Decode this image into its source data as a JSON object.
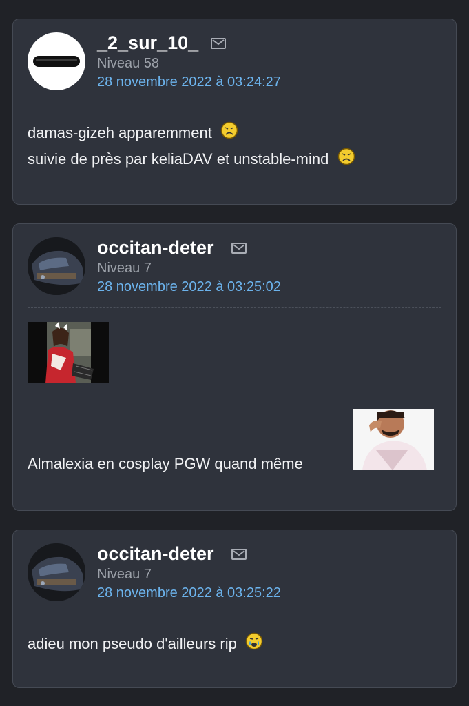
{
  "posts": [
    {
      "author": "_2_sur_10_",
      "level": "Niveau 58",
      "date": "28 novembre 2022 à 03:24:27",
      "lines": [
        "damas-gizeh apparemment",
        "suivie de près par keliaDAV et unstable-mind"
      ],
      "icons": [
        "mail-icon",
        "sad-smiley-icon"
      ]
    },
    {
      "author": "occitan-deter",
      "level": "Niveau 7",
      "date": "28 novembre 2022 à 03:25:02",
      "lines": [
        "Almalexia en cosplay PGW quand même"
      ],
      "icons": [
        "mail-icon",
        "cosplay-image",
        "crying-laughing-man-image"
      ]
    },
    {
      "author": "occitan-deter",
      "level": "Niveau 7",
      "date": "28 novembre 2022 à 03:25:22",
      "lines": [
        "adieu mon pseudo d'ailleurs rip"
      ],
      "icons": [
        "mail-icon",
        "crying-smiley-icon"
      ]
    }
  ]
}
